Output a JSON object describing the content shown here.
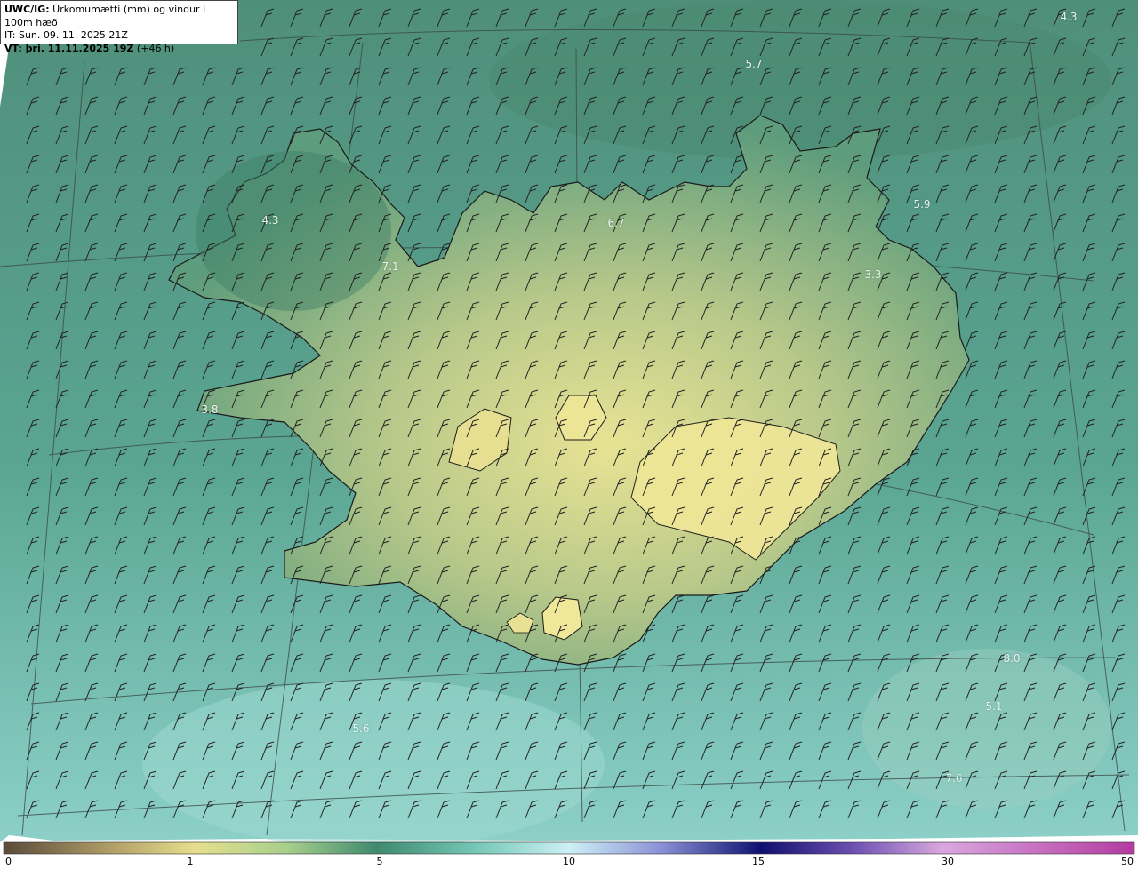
{
  "header": {
    "line1_prefix": "UWC/IG:",
    "line1_text": " Úrkomumætti (mm) og vindur i 100m hæð",
    "line2": "IT: Sun. 09. 11. 2025 21Z",
    "line3_prefix": "VT: þri. 11.11.2025 19Z",
    "line3_suffix": " (+46 h)"
  },
  "value_labels": [
    "4.3",
    "5.7",
    "6.7",
    "5.9",
    "4.3",
    "7.1",
    "3.3",
    "3.8",
    "5.6",
    "8.0",
    "5.1",
    "7.6"
  ],
  "colorbar": {
    "ticks": [
      "0",
      "1",
      "5",
      "10",
      "15",
      "30",
      "50"
    ],
    "colors": [
      "#5a4a3a",
      "#b5a36a",
      "#e6df8e",
      "#a8cf8c",
      "#3f8a6f",
      "#77c9b8",
      "#cdf0f5",
      "#8c93d6",
      "#101070",
      "#6b4fb0",
      "#d9a7e0",
      "#b43aa0"
    ]
  }
}
